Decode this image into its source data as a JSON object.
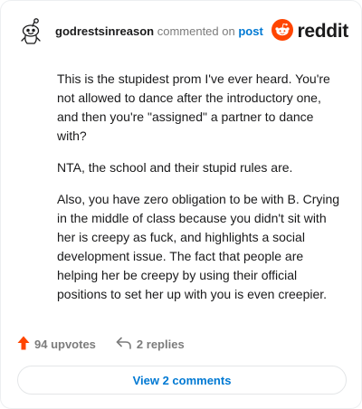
{
  "comment": {
    "username": "godrestsinreason",
    "action_text": "commented on",
    "post_link": "post",
    "paragraphs": [
      "This is the stupidest prom I've ever heard. You're not allowed to dance after the introductory one, and then you're \"assigned\" a partner to dance with?",
      "NTA, the school and their stupid rules are.",
      "Also, you have zero obligation to be with B. Crying in the middle of class because you didn't sit with her is creepy as fuck, and highlights a social development issue. The fact that people are helping her be creepy by using their official positions to set her up with you is even creepier."
    ]
  },
  "brand": {
    "name": "reddit",
    "color": "#ff4500"
  },
  "footer": {
    "upvotes_label": "94 upvotes",
    "replies_label": "2 replies",
    "view_comments_label": "View 2 comments"
  },
  "icons": {
    "avatar": "snoo-avatar-icon",
    "logo": "reddit-logo-icon",
    "upvote": "upvote-arrow-icon",
    "reply": "reply-arrow-icon"
  },
  "colors": {
    "link": "#0079d3",
    "muted": "#7c7c7c",
    "upvote": "#ff4500"
  }
}
